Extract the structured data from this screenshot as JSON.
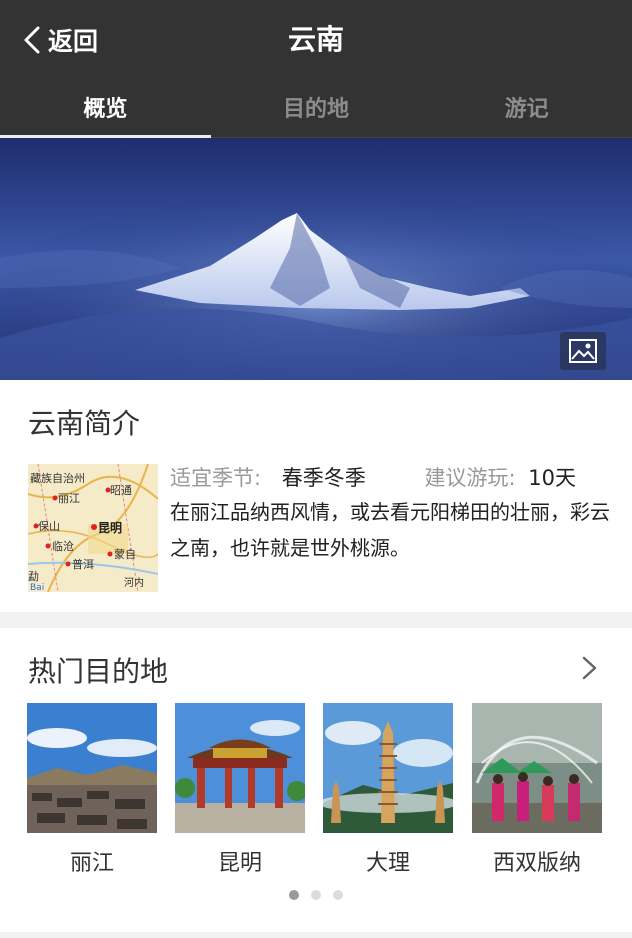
{
  "header": {
    "back_label": "返回",
    "title": "云南"
  },
  "tabs": [
    {
      "label": "概览",
      "active": true
    },
    {
      "label": "目的地",
      "active": false
    },
    {
      "label": "游记",
      "active": false
    }
  ],
  "banner": {
    "gallery_icon": "image-icon"
  },
  "intro": {
    "title": "云南简介",
    "map_labels": [
      "藏族自治州",
      "昭通",
      "丽江",
      "保山",
      "昆明",
      "临沧",
      "蒙自",
      "普洱",
      "河内",
      "勐",
      "Bai"
    ],
    "season_label": "适宜季节:",
    "season_value": "春季冬季",
    "duration_label": "建议游玩:",
    "duration_value": "10天",
    "description": "在丽江品纳西风情，或去看元阳梯田的壮丽，彩云之南，也许就是世外桃源。"
  },
  "hot": {
    "title": "热门目的地",
    "more_icon": "chevron-right-icon",
    "destinations": [
      {
        "name": "丽江"
      },
      {
        "name": "昆明"
      },
      {
        "name": "大理"
      },
      {
        "name": "西双版纳"
      }
    ],
    "pagination": {
      "pages": 3,
      "current": 1
    }
  },
  "colors": {
    "header_bg": "#333333",
    "page_bg": "#f2f2f2",
    "active_tab": "#ffffff",
    "inactive_tab": "#8c8c8c"
  }
}
